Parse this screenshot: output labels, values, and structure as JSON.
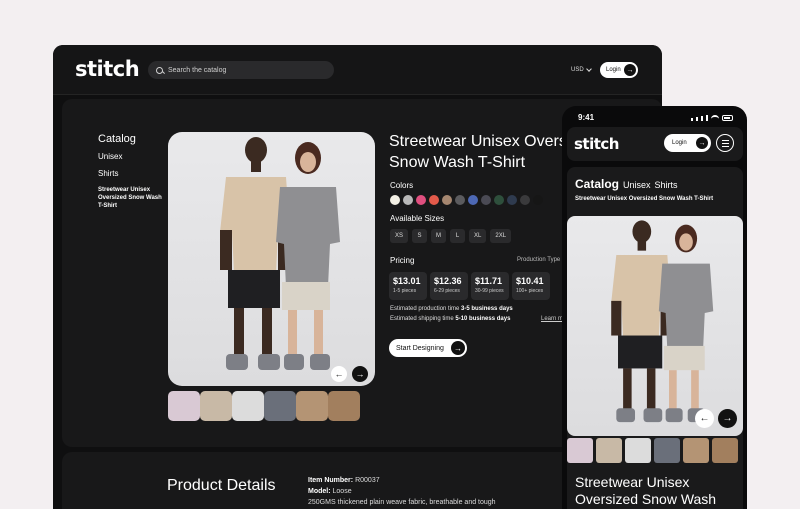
{
  "desktop": {
    "brand": "stitch",
    "search_placeholder": "Search the catalog",
    "currency": "USD",
    "login_label": "Login",
    "catalog_nav": {
      "heading": "Catalog",
      "items": [
        "Unisex",
        "Shirts"
      ],
      "current": "Streetwear Unisex Oversized Snow Wash T-Shirt"
    },
    "product": {
      "title_line1": "Streetwear Unisex Overs",
      "title_line2": "Snow Wash T-Shirt",
      "colors_label": "Colors",
      "colors": [
        "#f4f1e6",
        "#b9b9b9",
        "#e04f7f",
        "#e35a4a",
        "#a68770",
        "#5b5b5e",
        "#4d68b4",
        "#4a4a54",
        "#2e4f3c",
        "#2f3b4f",
        "#3a3a3c",
        "#161616"
      ],
      "sizes_label": "Available Sizes",
      "sizes": [
        "XS",
        "S",
        "M",
        "L",
        "XL",
        "2XL"
      ],
      "pricing_label": "Pricing",
      "production_type_label": "Production Type",
      "prices": [
        {
          "price": "$13.01",
          "qty": "1-5 pieces"
        },
        {
          "price": "$12.36",
          "qty": "6-29 pieces"
        },
        {
          "price": "$11.71",
          "qty": "30-99 pieces"
        },
        {
          "price": "$10.41",
          "qty": "100+ pieces"
        }
      ],
      "production_time_prefix": "Estimated production time",
      "production_time_value": "3-5 business days",
      "shipping_time_prefix": "Estimated shipping time",
      "shipping_time_value": "5-10 business days",
      "learn_more": "Learn m",
      "cta_label": "Start Designing"
    },
    "details": {
      "heading": "Product Details",
      "item_number_label": "Item Number:",
      "item_number": "R00037",
      "model_label": "Model:",
      "model": "Loose",
      "fabric": "250GMS thickened plain weave fabric, breathable and tough"
    }
  },
  "mobile": {
    "time": "9:41",
    "brand": "stitch",
    "login_label": "Login",
    "catalog": "Catalog",
    "cat_items": [
      "Unisex",
      "Shirts"
    ],
    "breadcrumb": "Streetwear Unisex Oversized Snow Wash T-Shirt",
    "title_line1": "Streetwear Unisex",
    "title_line2": "Oversized Snow Wash"
  },
  "icons": {
    "search": "search-icon",
    "arrow_right": "arrow-right-icon",
    "arrow_left": "arrow-left-icon",
    "menu": "hamburger-menu-icon",
    "chevron": "chevron-down-icon"
  },
  "thumb_colors": [
    "#d9c9d4",
    "#c8b9a6",
    "#dcdcdc",
    "#6a6f7a",
    "#b49474",
    "#a27f5e"
  ]
}
